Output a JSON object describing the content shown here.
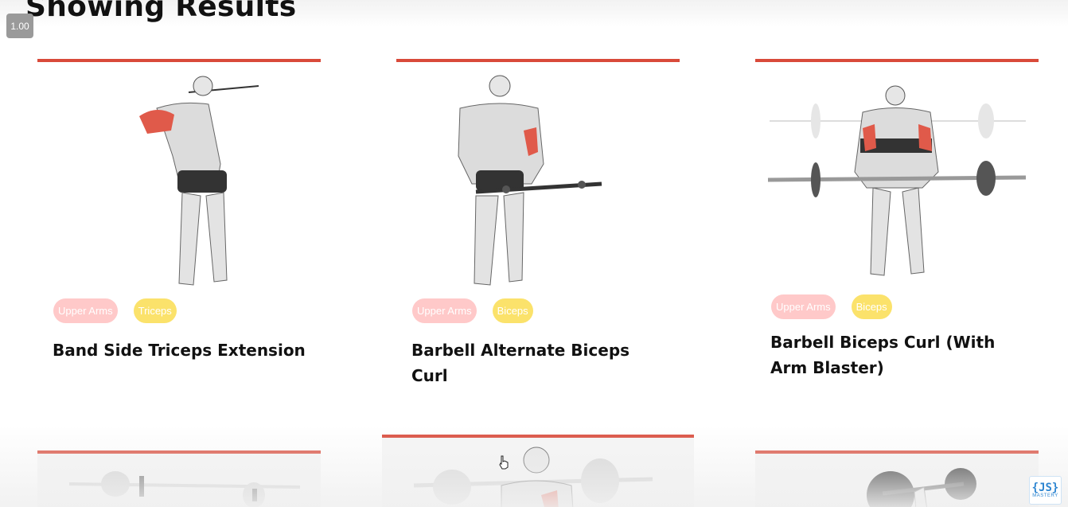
{
  "header": {
    "title": "Showing Results",
    "zoom": "1.00"
  },
  "cards": [
    {
      "name": "Band Side Triceps Extension",
      "body_part": "Upper Arms",
      "target": "Triceps"
    },
    {
      "name": "Barbell Alternate Biceps Curl",
      "body_part": "Upper Arms",
      "target": "Biceps"
    },
    {
      "name": "Barbell Biceps Curl (With Arm Blaster)",
      "body_part": "Upper Arms",
      "target": "Biceps"
    }
  ],
  "watermark": {
    "logo_text": "{JS}",
    "logo_sub": "MASTERY"
  },
  "colors": {
    "accent": "#d94a3a",
    "body_tag": "#ffc9c9",
    "target_tag": "#fbe26b"
  },
  "icons": [
    "exercise-figure-icon",
    "pointer-hand-icon",
    "jsm-logo-icon"
  ]
}
